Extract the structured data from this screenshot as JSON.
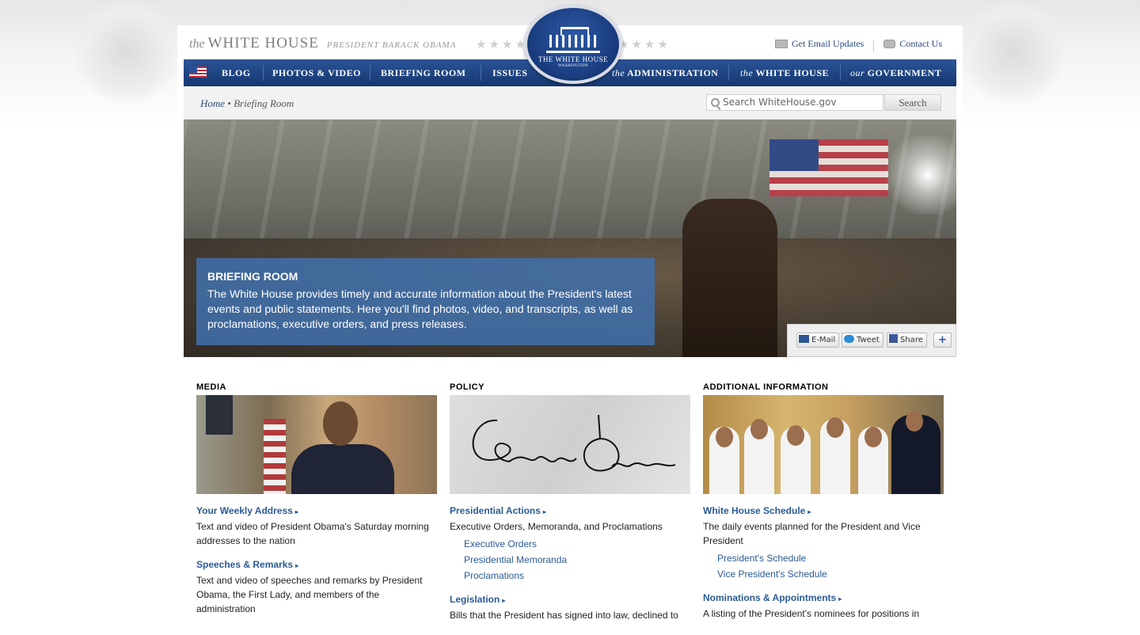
{
  "header": {
    "brand_the": "the",
    "brand_name": "WHITE HOUSE",
    "brand_sub": "PRESIDENT BARACK OBAMA",
    "seal_line1": "THE WHITE HOUSE",
    "seal_line2": "WASHINGTON",
    "email_updates": "Get Email Updates",
    "contact_us": "Contact Us"
  },
  "nav": {
    "blog": "BLOG",
    "photos": "PHOTOS & VIDEO",
    "briefing": "BRIEFING ROOM",
    "issues": "ISSUES",
    "admin_pre": "the",
    "admin": "ADMINISTRATION",
    "wh_pre": "the",
    "wh": "WHITE HOUSE",
    "gov_pre": "our",
    "gov": "GOVERNMENT"
  },
  "breadcrumb": {
    "home": "Home",
    "separator": "•",
    "current": "Briefing Room"
  },
  "search": {
    "placeholder": "Search WhiteHouse.gov",
    "button": "Search"
  },
  "hero": {
    "title": "BRIEFING ROOM",
    "description": "The White House provides timely and accurate information about the President's latest events and public statements. Here you'll find photos, video, and transcripts, as well as proclamations, executive orders, and press releases.",
    "share": {
      "email": "E-Mail",
      "tweet": "Tweet",
      "share": "Share",
      "more": "+"
    }
  },
  "columns": {
    "media": {
      "heading": "MEDIA",
      "links": [
        {
          "label": "Your Weekly Address",
          "text": "Text and video of President Obama's Saturday morning addresses to the nation"
        },
        {
          "label": "Speeches & Remarks",
          "text": "Text and video of speeches and remarks by President Obama, the First Lady, and members of the administration"
        }
      ]
    },
    "policy": {
      "heading": "POLICY",
      "signature_text": "Barack Obama",
      "links": [
        {
          "label": "Presidential Actions",
          "text": "Executive Orders, Memoranda, and Proclamations"
        },
        {
          "label": "Legislation",
          "text": "Bills that the President has signed into law, declined to"
        }
      ],
      "sublinks": [
        "Executive Orders",
        "Presidential Memoranda",
        "Proclamations"
      ]
    },
    "info": {
      "heading": "ADDITIONAL INFORMATION",
      "links": [
        {
          "label": "White House Schedule",
          "text": "The daily events planned for the President and Vice President"
        },
        {
          "label": "Nominations & Appointments",
          "text": "A listing of the President's nominees for positions in"
        }
      ],
      "sublinks": [
        "President's Schedule",
        "Vice President's Schedule"
      ]
    }
  },
  "arrow": "▸",
  "stars": "★★★★",
  "colors": {
    "nav_blue": "#1f4583",
    "link_blue": "#2b5b96",
    "hero_box": "#406ea8"
  }
}
